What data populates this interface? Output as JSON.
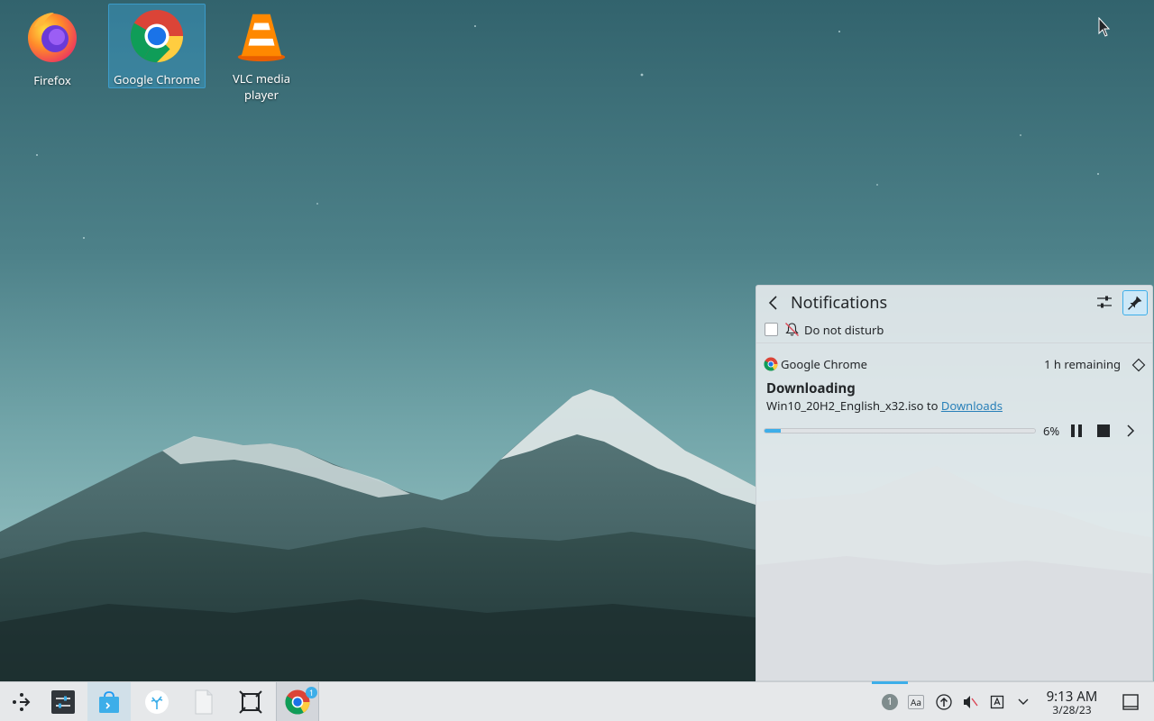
{
  "desktop": {
    "icons": [
      {
        "label": "Firefox"
      },
      {
        "label": "Google Chrome"
      },
      {
        "label": "VLC media player"
      }
    ]
  },
  "notifications": {
    "title": "Notifications",
    "do_not_disturb_label": "Do not disturb",
    "do_not_disturb_checked": false,
    "item": {
      "app_name": "Google Chrome",
      "remaining": "1 h remaining",
      "heading": "Downloading",
      "file_text": "Win10_20H2_English_x32.iso to ",
      "link_text": "Downloads",
      "progress_percent": 6,
      "progress_label": "6%"
    }
  },
  "taskbar": {
    "chrome_badge": "1",
    "tray_updates_badge": "1",
    "tray_font_label": "Aa",
    "clock_time": "9:13 AM",
    "clock_date": "3/28/23"
  },
  "colors": {
    "accent": "#3daee9",
    "link": "#2980b9"
  }
}
